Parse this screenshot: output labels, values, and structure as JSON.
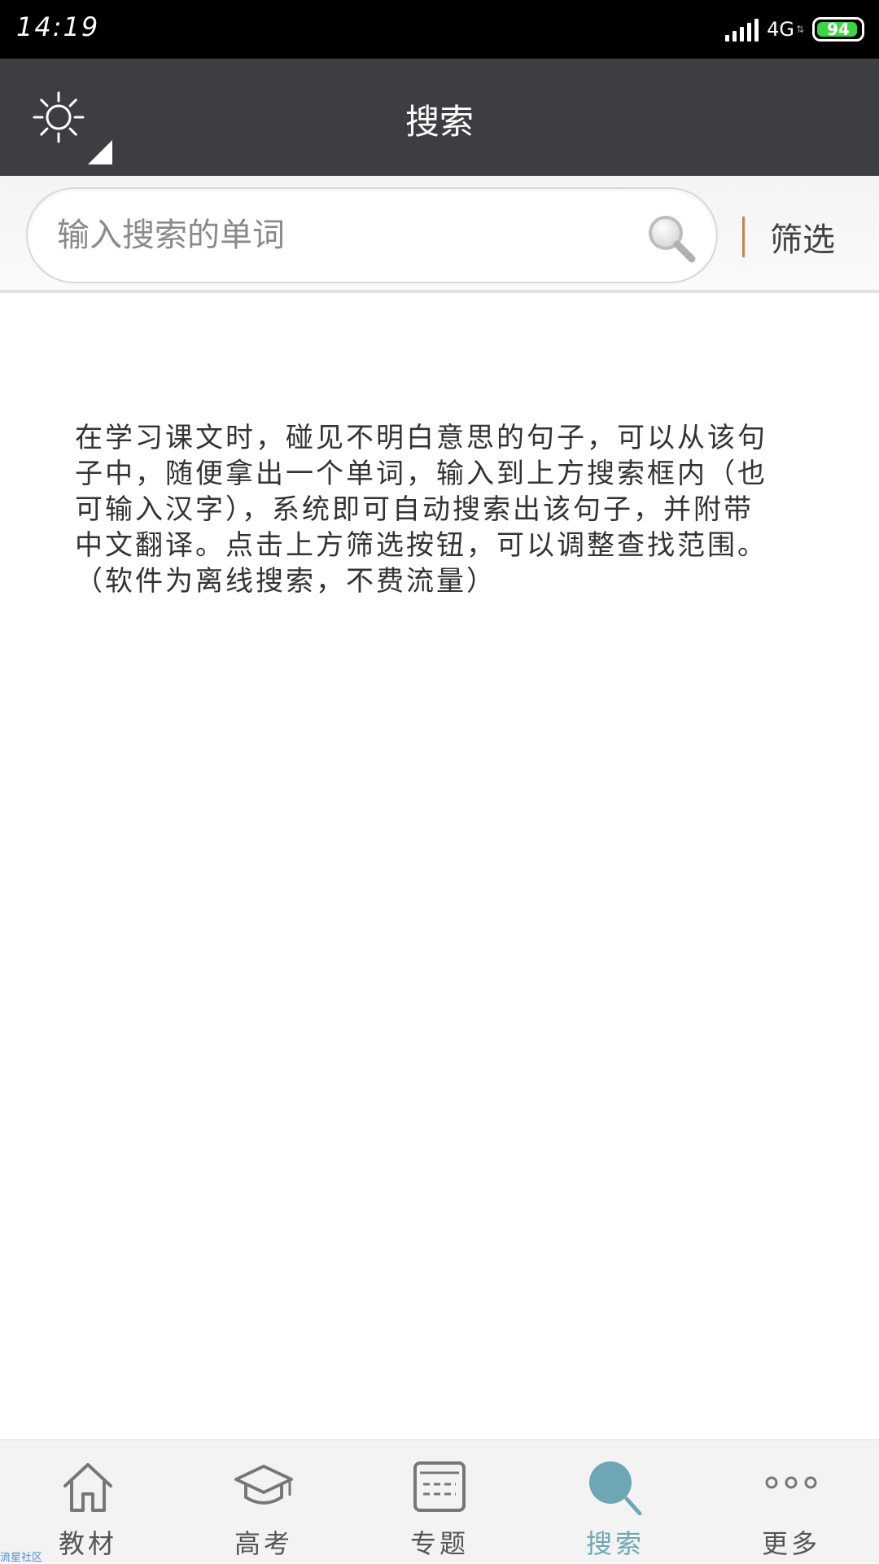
{
  "status_bar": {
    "time": "14:19",
    "network": "4G",
    "battery": "94",
    "battery_level": 0.94,
    "battery_color": "#3bd641"
  },
  "header": {
    "title": "搜索",
    "left_icon": "sun-icon"
  },
  "search": {
    "placeholder": "输入搜索的单词",
    "value": "",
    "filter_label": "筛选",
    "accent_color": "#c8814e"
  },
  "help_text": "在学习课文时，碰见不明白意思的句子，可以从该句子中，随便拿出一个单词，输入到上方搜索框内（也可输入汉字），系统即可自动搜索出该句子，并附带中文翻译。点击上方筛选按钮，可以调整查找范围。（软件为离线搜索，不费流量）",
  "watermark": "流星社区",
  "tabs": [
    {
      "label": "教材",
      "icon": "home-icon",
      "active": false
    },
    {
      "label": "高考",
      "icon": "graduation-cap-icon",
      "active": false
    },
    {
      "label": "专题",
      "icon": "card-icon",
      "active": false
    },
    {
      "label": "搜索",
      "icon": "search-icon",
      "active": true
    },
    {
      "label": "更多",
      "icon": "more-icon",
      "active": false
    }
  ],
  "colors": {
    "header_bg": "#3d3e42",
    "active_tab": "#6fa6b6",
    "inactive_icon": "#777777"
  }
}
